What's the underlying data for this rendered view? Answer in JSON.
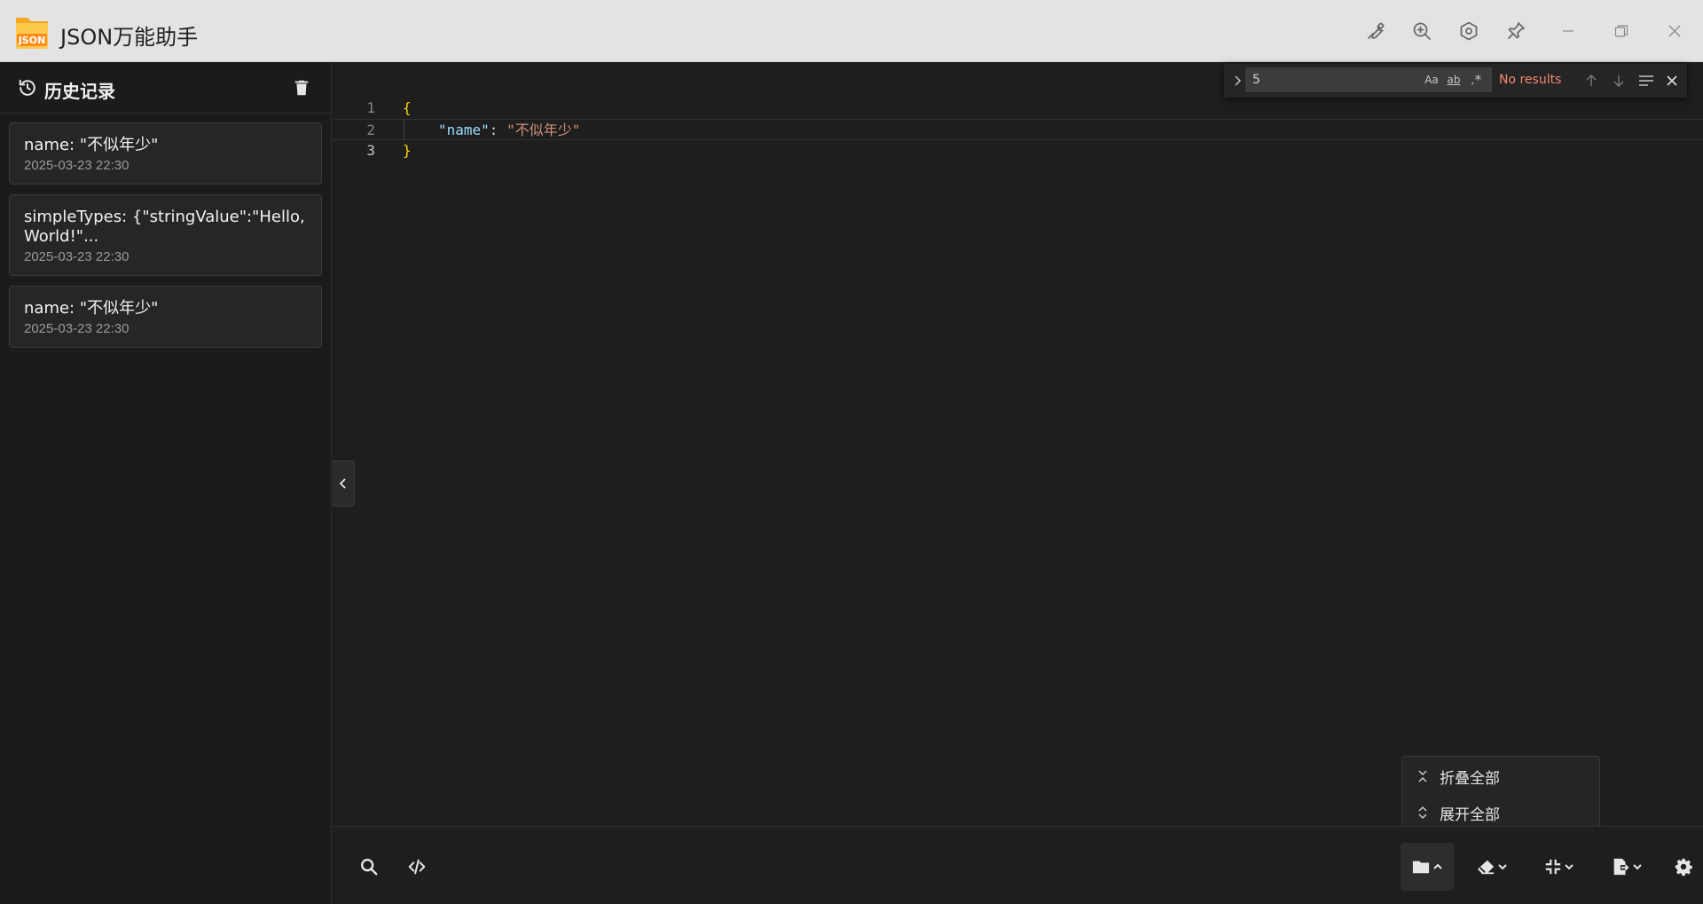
{
  "app": {
    "title": "JSON万能助手",
    "logo_text": "JSON"
  },
  "sidebar": {
    "title": "历史记录",
    "items": [
      {
        "title": "name: \"不似年少\"",
        "date": "2025-03-23 22:30"
      },
      {
        "title": "simpleTypes: {\"stringValue\":\"Hello, World!\"...",
        "date": "2025-03-23 22:30"
      },
      {
        "title": "name: \"不似年少\"",
        "date": "2025-03-23 22:30"
      }
    ]
  },
  "editor": {
    "lines": [
      {
        "num": "1",
        "open": "{"
      },
      {
        "num": "2",
        "key": "\"name\"",
        "colon": ": ",
        "value": "\"不似年少\""
      },
      {
        "num": "3",
        "close": "}"
      }
    ]
  },
  "find": {
    "value": "5",
    "match_case": "Aa",
    "whole_word": "ab",
    "regex": ".*",
    "result": "No results"
  },
  "dropdown": {
    "items": [
      {
        "label": "折叠全部"
      },
      {
        "label": "展开全部"
      }
    ]
  },
  "colors": {
    "brace": "#ffd700",
    "key": "#9cdcfe",
    "string": "#ce9178",
    "no_results": "#f48771"
  }
}
